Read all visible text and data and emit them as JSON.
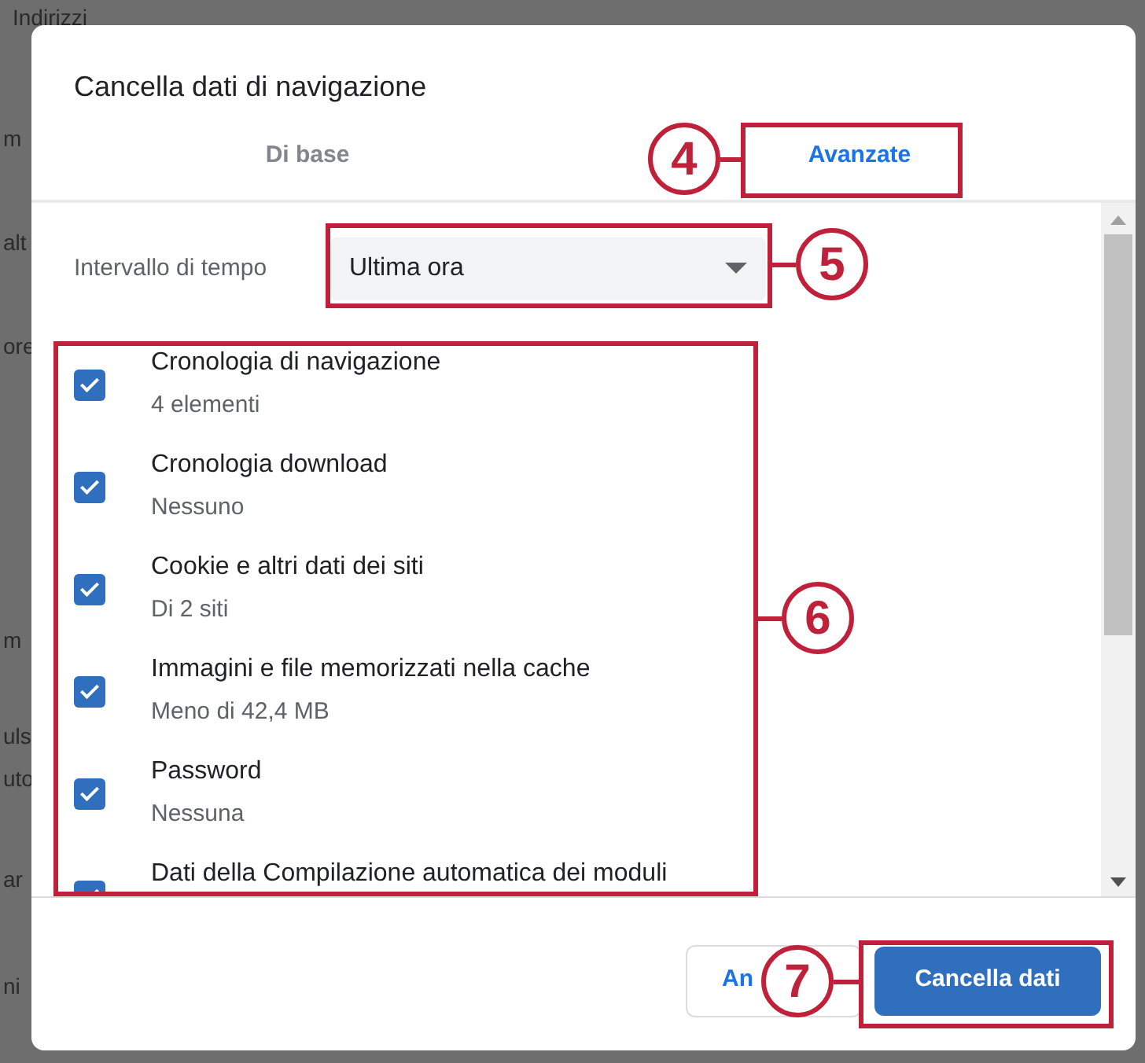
{
  "background_fragments": [
    "Indirizzi",
    "m",
    "alt",
    "ore",
    "m",
    "uls",
    "uto",
    "ar",
    "ni"
  ],
  "dialog": {
    "title": "Cancella dati di navigazione",
    "tabs": [
      {
        "label": "Di base",
        "selected": false
      },
      {
        "label": "Avanzate",
        "selected": true
      }
    ],
    "time_range": {
      "label": "Intervallo di tempo",
      "value": "Ultima ora"
    },
    "items": [
      {
        "label": "Cronologia di navigazione",
        "detail": "4 elementi",
        "checked": true
      },
      {
        "label": "Cronologia download",
        "detail": "Nessuno",
        "checked": true
      },
      {
        "label": "Cookie e altri dati dei siti",
        "detail": "Di 2 siti",
        "checked": true
      },
      {
        "label": "Immagini e file memorizzati nella cache",
        "detail": "Meno di 42,4 MB",
        "checked": true
      },
      {
        "label": "Password",
        "detail": "Nessuna",
        "checked": true
      },
      {
        "label": "Dati della Compilazione automatica dei moduli",
        "checked": true
      }
    ],
    "buttons": [
      {
        "label": "An",
        "kind": "secondary"
      },
      {
        "label": "Cancella dati",
        "kind": "primary"
      }
    ]
  },
  "callouts": [
    "4",
    "5",
    "6",
    "7"
  ]
}
